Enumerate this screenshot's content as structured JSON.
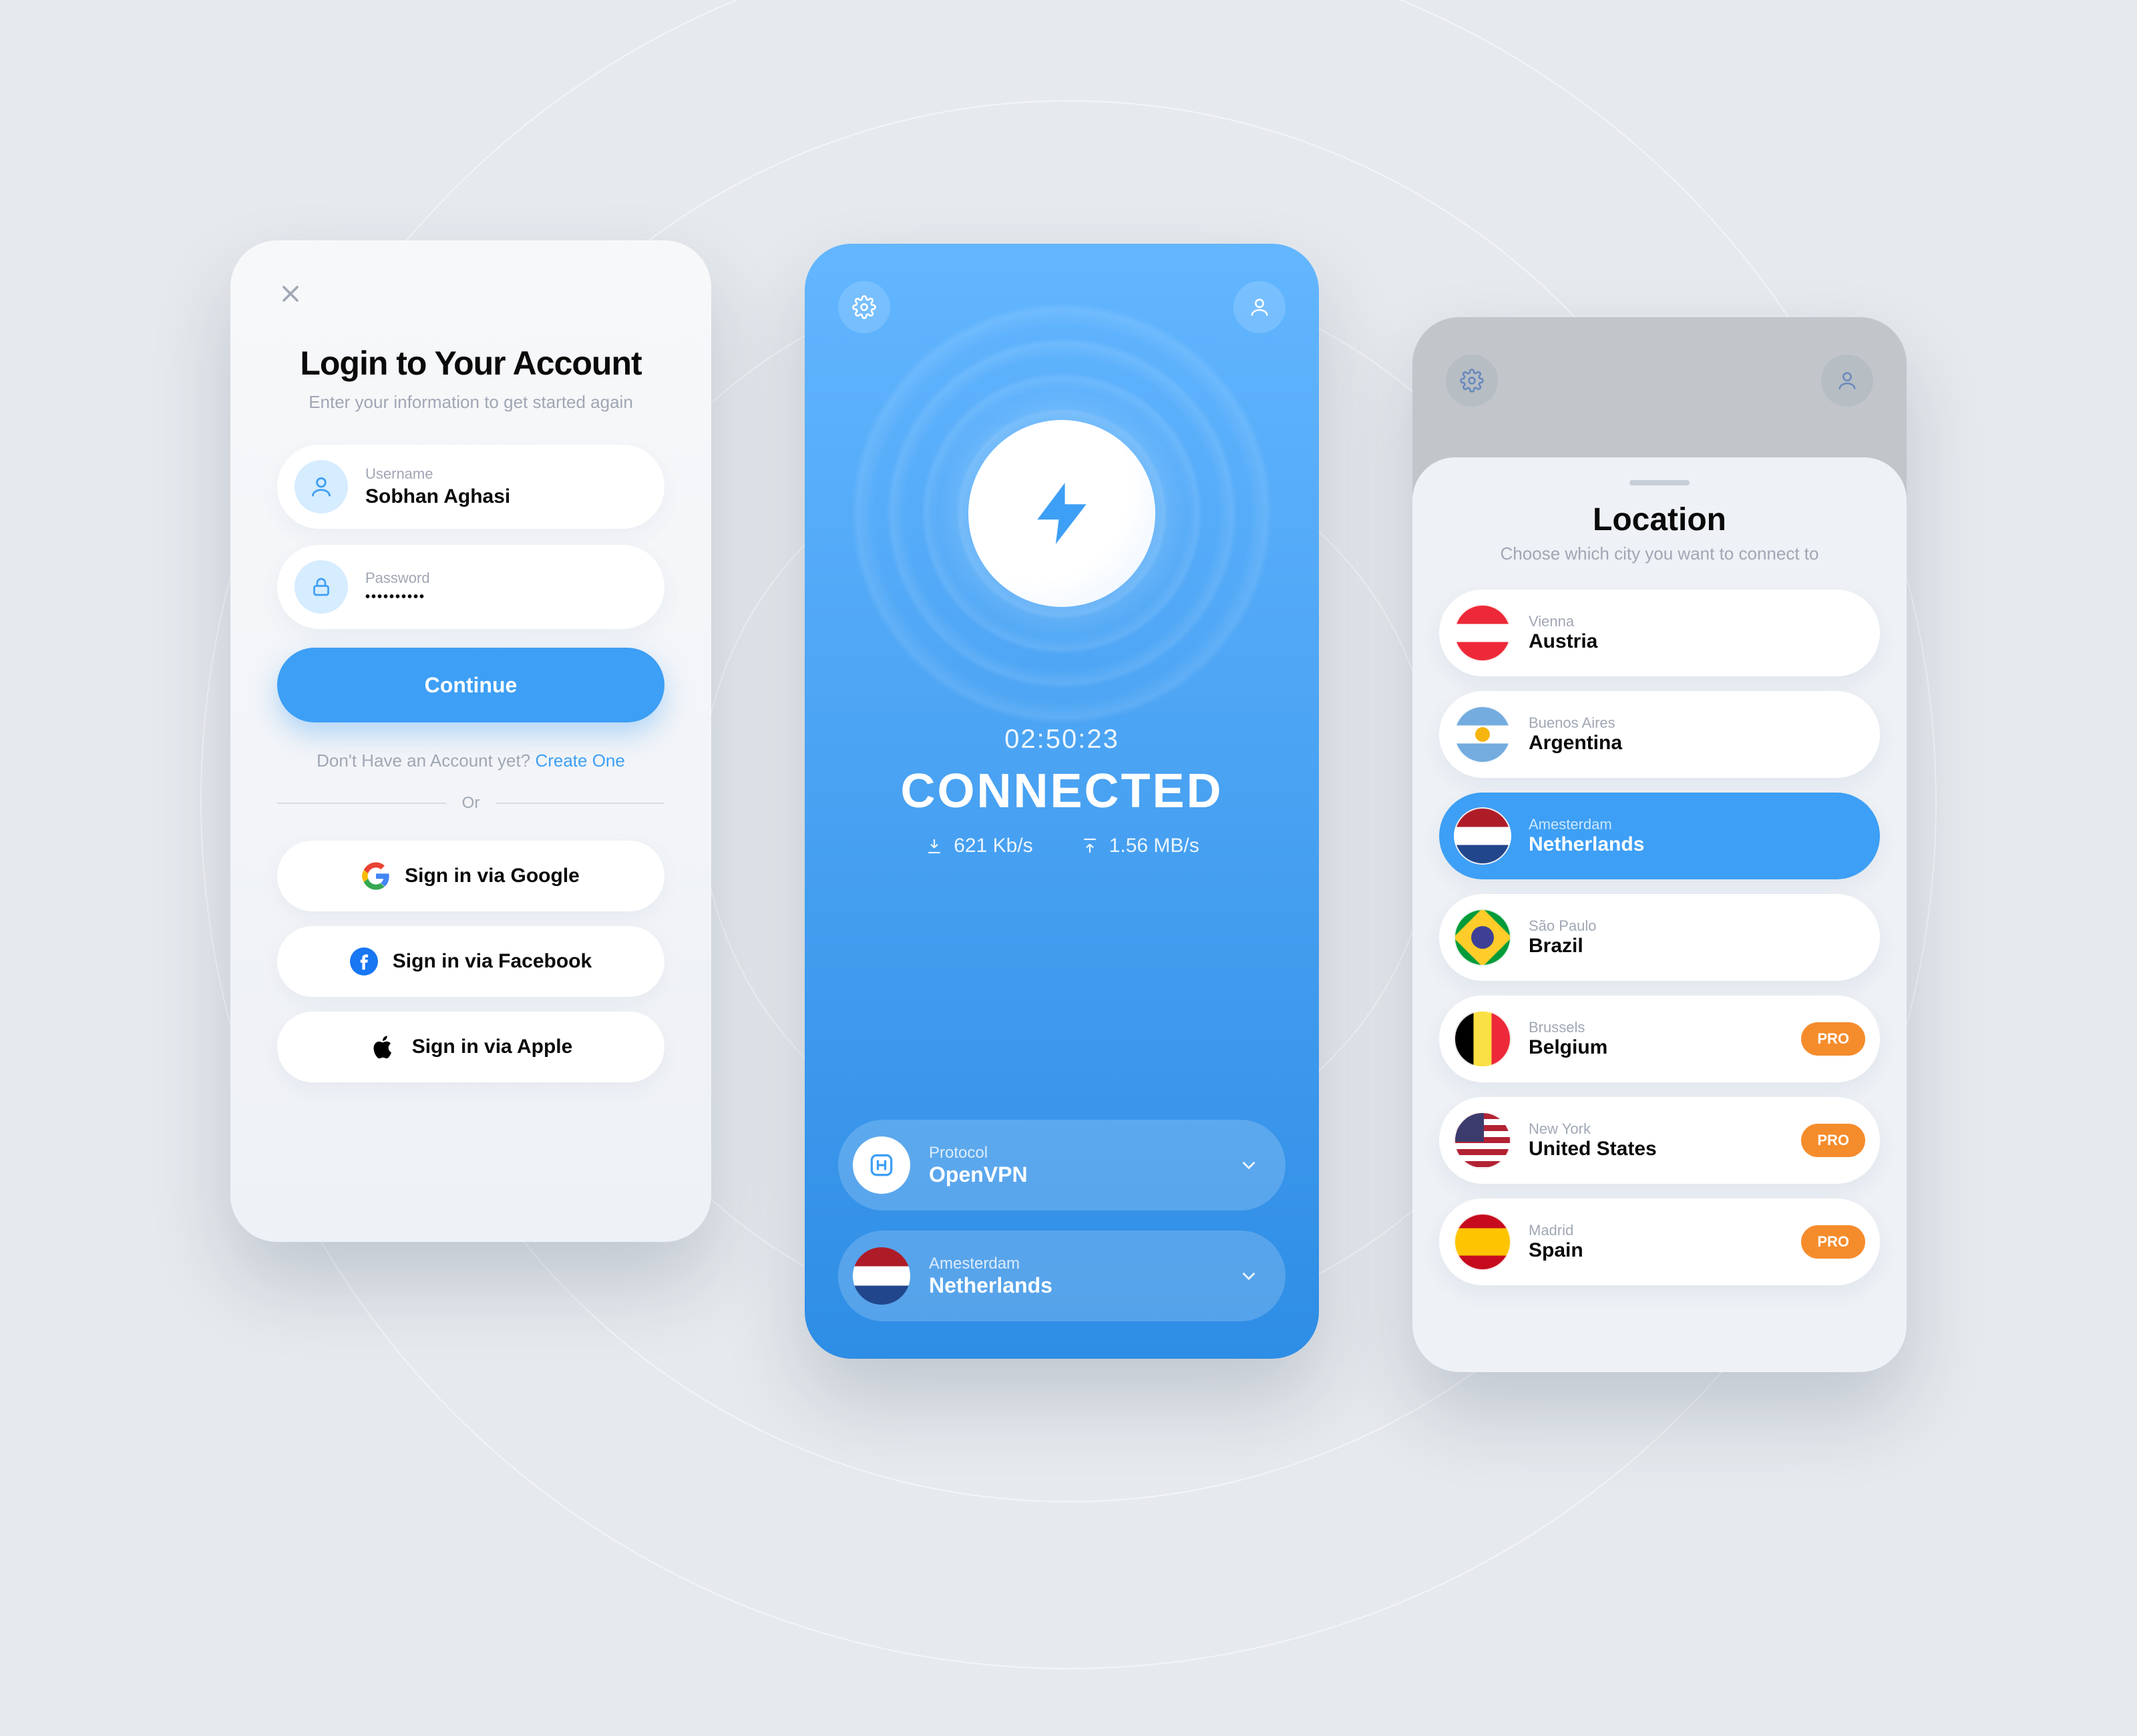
{
  "login": {
    "title": "Login to Your Account",
    "subtitle": "Enter your information to get started again",
    "username": {
      "label": "Username",
      "value": "Sobhan Aghasi"
    },
    "password": {
      "label": "Password",
      "value": "••••••••••"
    },
    "continue": "Continue",
    "create_prefix": "Don't Have an Account yet? ",
    "create_link": "Create One",
    "or": "Or",
    "social": {
      "google": "Sign in via Google",
      "facebook": "Sign in via Facebook",
      "apple": "Sign in via Apple"
    }
  },
  "connected": {
    "timer": "02:50:23",
    "status": "CONNECTED",
    "download": "621 Kb/s",
    "upload": "1.56 MB/s",
    "protocol": {
      "label": "Protocol",
      "value": "OpenVPN"
    },
    "location": {
      "label": "Amesterdam",
      "value": "Netherlands"
    }
  },
  "location": {
    "title": "Location",
    "subtitle": "Choose which city you want to connect to",
    "items": [
      {
        "city": "Vienna",
        "country": "Austria",
        "flag": "austria",
        "selected": false,
        "pro": false
      },
      {
        "city": "Buenos Aires",
        "country": "Argentina",
        "flag": "argentina",
        "selected": false,
        "pro": false
      },
      {
        "city": "Amesterdam",
        "country": "Netherlands",
        "flag": "netherlands",
        "selected": true,
        "pro": false
      },
      {
        "city": "São Paulo",
        "country": "Brazil",
        "flag": "brazil",
        "selected": false,
        "pro": false
      },
      {
        "city": "Brussels",
        "country": "Belgium",
        "flag": "belgium",
        "selected": false,
        "pro": true
      },
      {
        "city": "New York",
        "country": "United States",
        "flag": "us",
        "selected": false,
        "pro": true
      },
      {
        "city": "Madrid",
        "country": "Spain",
        "flag": "spain",
        "selected": false,
        "pro": true
      }
    ],
    "pro_label": "PRO"
  }
}
